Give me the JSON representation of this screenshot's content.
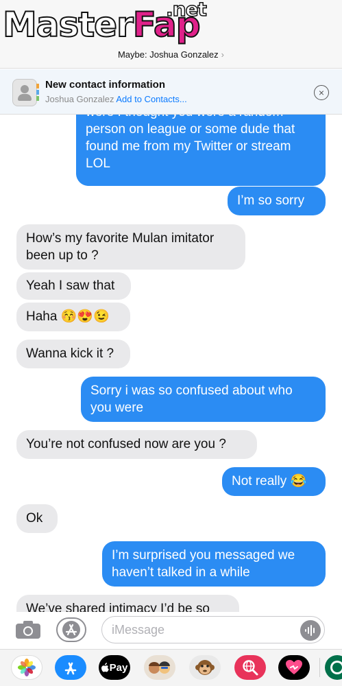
{
  "watermark": {
    "part1": "Master",
    "part2": "Fap",
    "part3": ".net"
  },
  "header": {
    "contact": "Maybe: Joshua Gonzalez",
    "chevron": "›"
  },
  "banner": {
    "title": "New contact information",
    "name": "Joshua Gonzalez",
    "link": "Add to Contacts...",
    "close": "×"
  },
  "messages": [
    {
      "dir": "sent",
      "text": "were I thought you were a random person on league or some dude that found me from my Twitter or stream LOL"
    },
    {
      "dir": "sent",
      "text": "I’m so sorry"
    },
    {
      "dir": "recv",
      "text": "How’s my favorite Mulan imitator been up to ?"
    },
    {
      "dir": "recv",
      "text": "Yeah I saw that"
    },
    {
      "dir": "recv",
      "text": "Haha 😚😍😉"
    },
    {
      "dir": "recv",
      "text": "Wanna kick it ?"
    },
    {
      "dir": "sent",
      "text": "Sorry i was so confused about who you were"
    },
    {
      "dir": "recv",
      "text": "You’re not confused now are you ?"
    },
    {
      "dir": "sent",
      "text": "Not really 😂"
    },
    {
      "dir": "recv",
      "text": "Ok"
    },
    {
      "dir": "sent",
      "text": "I’m surprised you messaged we haven’t talked in a while"
    },
    {
      "dir": "recv",
      "text": "We’ve shared intimacy I’d be so"
    }
  ],
  "composer": {
    "placeholder": "iMessage"
  },
  "drawer": {
    "apple_pay_label": "Pay",
    "apps": [
      "photos-app",
      "app-store-app",
      "apple-pay-app",
      "memoji-app",
      "animoji-app",
      "web-search-app",
      "digital-touch-app",
      "starbucks-app"
    ]
  },
  "colors": {
    "sent": "#2b8cf3",
    "received": "#e9e9eb",
    "link": "#0a7aff",
    "watermark_accent": "#e0218a"
  }
}
